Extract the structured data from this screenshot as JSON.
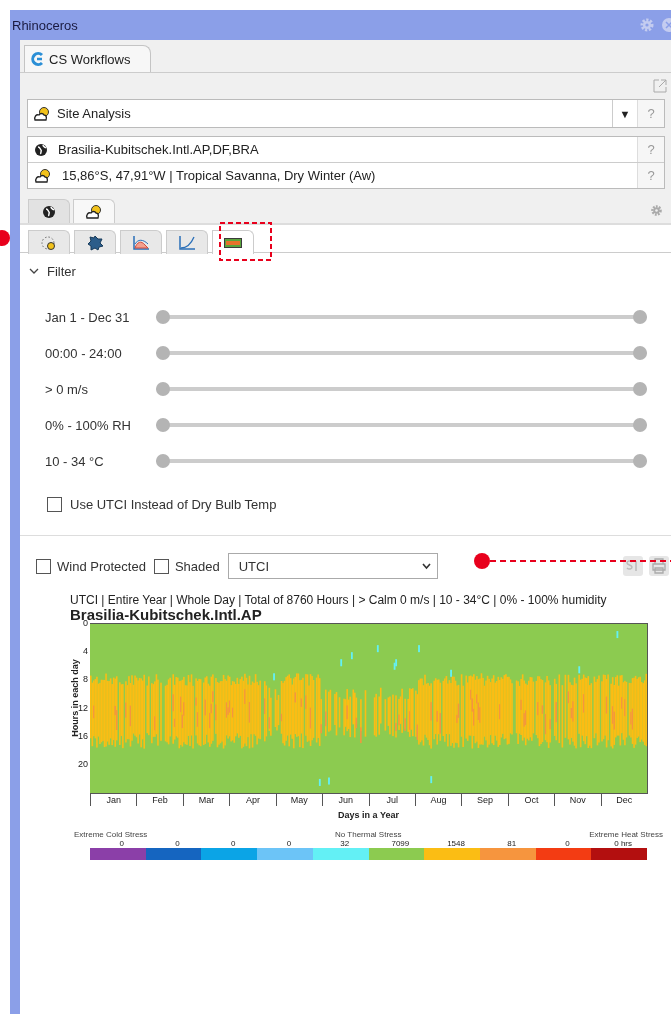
{
  "window": {
    "title": "Rhinoceros"
  },
  "panel_tabs": [
    {
      "label": "CS Workflows",
      "selected": true
    }
  ],
  "workflow": {
    "value": "Site Analysis",
    "arrow": "▼",
    "help": "?"
  },
  "location": [
    {
      "kind": "globe",
      "text": "Brasilia-Kubitschek.Intl.AP,DF,BRA",
      "help": "?"
    },
    {
      "kind": "weather",
      "text": "15,86°S, 47,91°W | Tropical Savanna, Dry Winter (Aw)",
      "help": "?"
    }
  ],
  "main_tabs": [
    {
      "kind": "globe",
      "selected": false
    },
    {
      "kind": "weather",
      "selected": true
    }
  ],
  "tool_tabs": [
    {
      "kind": "sun-path",
      "selected": false
    },
    {
      "kind": "wind",
      "selected": false
    },
    {
      "kind": "area",
      "selected": false
    },
    {
      "kind": "curve",
      "selected": false
    },
    {
      "kind": "heatmap",
      "selected": true
    }
  ],
  "filter": {
    "title": "Filter",
    "expanded": true,
    "sliders": [
      {
        "label": "Jan 1 - Dec 31",
        "level": 1
      },
      {
        "label": "00:00 - 24:00",
        "level": 1
      },
      {
        "label": "> 0 m/s",
        "level": 1
      },
      {
        "label": "0% - 100% RH",
        "level": 1
      },
      {
        "label": "10 - 34 °C",
        "level": 1
      }
    ],
    "utci": {
      "label": "Use UTCI Instead of Dry Bulb Temp",
      "checked": false
    }
  },
  "options": {
    "wind_protected": {
      "label": "Wind Protected",
      "checked": false
    },
    "shaded": {
      "label": "Shaded",
      "checked": false
    },
    "metric": {
      "value": "UTCI"
    }
  },
  "chart": {
    "subtitle": "UTCI | Entire Year | Whole Day | Total of 8760 Hours | > Calm 0 m/s | 10 - 34°C | 0% - 100% humidity",
    "title": "Brasilia-Kubitschek.Intl.AP",
    "ylabel": "Hours in each day",
    "xlabel": "Days in a Year",
    "yticks": [
      "0",
      "4",
      "8",
      "12",
      "16",
      "20"
    ],
    "months": [
      "Jan",
      "Feb",
      "Mar",
      "Apr",
      "May",
      "Jun",
      "Jul",
      "Aug",
      "Sep",
      "Oct",
      "Nov",
      "Dec"
    ],
    "legend": {
      "left": "Extreme Cold Stress",
      "center": "No Thermal Stress",
      "right": "Extreme Heat Stress",
      "bins": [
        {
          "count": "0",
          "color": "#8b3fa8"
        },
        {
          "count": "0",
          "color": "#1565c0"
        },
        {
          "count": "0",
          "color": "#0ba4e6"
        },
        {
          "count": "0",
          "color": "#6cc4f7"
        },
        {
          "count": "32",
          "color": "#63f0f5"
        },
        {
          "count": "7099",
          "color": "#8ccb50"
        },
        {
          "count": "1548",
          "color": "#fbbd14"
        },
        {
          "count": "81",
          "color": "#f6953e"
        },
        {
          "count": "0",
          "color": "#f33c13"
        },
        {
          "count": "0 hrs",
          "color": "#b30f0f"
        }
      ]
    }
  }
}
